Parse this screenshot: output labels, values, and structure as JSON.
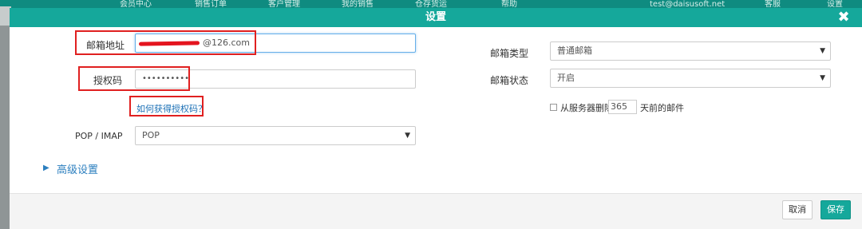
{
  "background_nav": {
    "items": [
      "会员中心",
      "销售订单",
      "客户管理",
      "我的销售",
      "仓存货运",
      "帮助",
      "test@daisusoft.net",
      "客服",
      "设置"
    ]
  },
  "dialog": {
    "title": "设置",
    "close_glyph": "✖"
  },
  "form": {
    "email_label": "邮箱地址",
    "email_value": "@126.com",
    "auth_label": "授权码",
    "auth_value": "••••••••••",
    "help_link": "如何获得授权码？",
    "protocol_label": "POP / IMAP",
    "protocol_value": "POP",
    "mailbox_type_label": "邮箱类型",
    "mailbox_type_value": "普通邮箱",
    "mailbox_status_label": "邮箱状态",
    "mailbox_status_value": "开启",
    "delete_text_before": "从服务器删除",
    "delete_days": "365",
    "delete_text_after": "天前的邮件",
    "advanced_label": "高级设置",
    "caret_glyph": "▼",
    "advanced_glyph": "▶"
  },
  "footer": {
    "cancel_label": "取消",
    "save_label": "保存"
  },
  "colors": {
    "header": "#15a89b",
    "annotation": "#e02020",
    "link": "#1a6fb5"
  }
}
